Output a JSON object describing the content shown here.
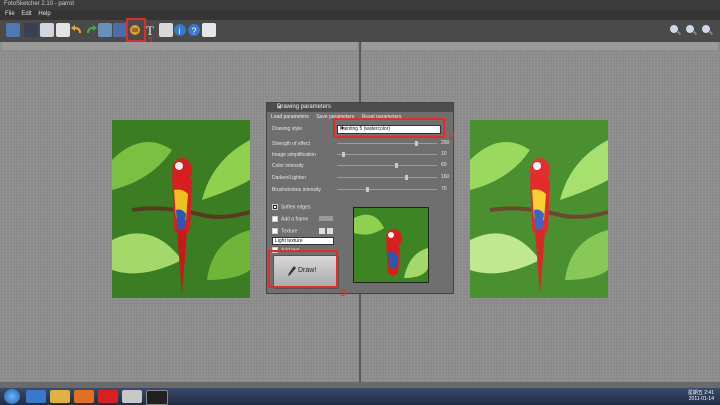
{
  "window": {
    "title": "FotoSketcher 2.10 - parrot"
  },
  "menu": {
    "items": [
      "File",
      "Edit",
      "Help"
    ]
  },
  "annotations": {
    "one": "1",
    "two": "2",
    "three": "3"
  },
  "dialog": {
    "title": "Drawing parameters",
    "menu": [
      "Load parameters",
      "Save parameters",
      "Reset parameters"
    ],
    "style_label": "Drawing style",
    "style_value": "Painting 5 (watercolor)",
    "sliders": [
      {
        "label": "Strength of effect",
        "value": "200",
        "pos": 0.8
      },
      {
        "label": "Image simplification",
        "value": "10",
        "pos": 0.05
      },
      {
        "label": "Color intensity",
        "value": "60",
        "pos": 0.6
      },
      {
        "label": "Darken/Lighten",
        "value": "160",
        "pos": 0.7
      },
      {
        "label": "Brushstrokes intensity",
        "value": "70",
        "pos": 0.3
      }
    ],
    "soften_edges": "Soften edges",
    "add_frame": "Add a frame",
    "texture": "Texture",
    "texture_value": "Light texture",
    "add_text": "Add text",
    "draw_button": "Draw!"
  },
  "clock": {
    "time": "2:41",
    "date": "2011-01-14",
    "day": "星期五"
  },
  "colors": {
    "accent": "#e52a2a"
  }
}
